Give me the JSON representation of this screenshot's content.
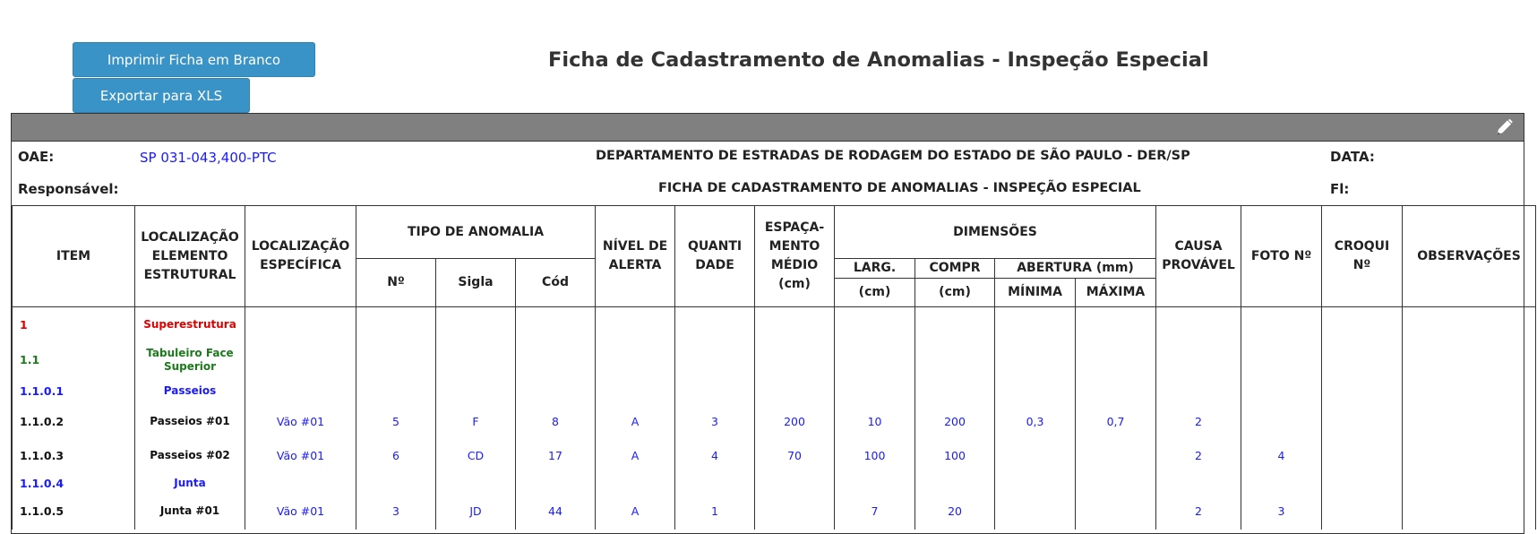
{
  "buttons": {
    "print": "Imprimir Ficha em Branco",
    "export": "Exportar para XLS"
  },
  "page_title": "Ficha de Cadastramento de Anomalias - Inspeção Especial",
  "header": {
    "oae_label": "OAE:",
    "oae_value": "SP 031-043,400-PTC",
    "dept": "DEPARTAMENTO DE ESTRADAS DE RODAGEM DO ESTADO DE SÃO PAULO - DER/SP",
    "data_label": "DATA:",
    "responsavel_label": "Responsável:",
    "ficha": "FICHA DE CADASTRAMENTO DE ANOMALIAS - INSPEÇÃO ESPECIAL",
    "fl_label": "Fl:"
  },
  "columns": {
    "item": "ITEM",
    "loc_elemento": "LOCALIZAÇÃO ELEMENTO ESTRUTURAL",
    "loc_especifica": "LOCALIZAÇÃO ESPECÍFICA",
    "tipo_anomalia": "TIPO DE ANOMALIA",
    "num": "Nº",
    "sigla": "Sigla",
    "cod": "Cód",
    "nivel_alerta": "NÍVEL DE ALERTA",
    "quantidade": "QUANTI DADE",
    "espacamento": "ESPAÇA- MENTO MÉDIO",
    "espacamento_unit": "(cm)",
    "dimensoes": "DIMENSÕES",
    "larg": "LARG.",
    "larg_unit": "(cm)",
    "compr": "COMPR",
    "compr_unit": "(cm)",
    "abertura": "ABERTURA (mm)",
    "minima": "MÍNIMA",
    "maxima": "MÁXIMA",
    "causa": "CAUSA PROVÁVEL",
    "foto": "FOTO Nº",
    "croqui": "CROQUI Nº",
    "observacoes": "OBSERVAÇÕES"
  },
  "rows": [
    {
      "item": "1",
      "loc": "Superestrutura",
      "espec": "",
      "num": "",
      "sigla": "",
      "cod": "",
      "nivel": "",
      "qtd": "",
      "esp": "",
      "larg": "",
      "compr": "",
      "min": "",
      "max": "",
      "causa": "",
      "foto": "",
      "croqui": "",
      "obs": ""
    },
    {
      "item": "1.1",
      "loc": "Tabuleiro Face Superior",
      "espec": "",
      "num": "",
      "sigla": "",
      "cod": "",
      "nivel": "",
      "qtd": "",
      "esp": "",
      "larg": "",
      "compr": "",
      "min": "",
      "max": "",
      "causa": "",
      "foto": "",
      "croqui": "",
      "obs": ""
    },
    {
      "item": "1.1.0.1",
      "loc": "Passeios",
      "espec": "",
      "num": "",
      "sigla": "",
      "cod": "",
      "nivel": "",
      "qtd": "",
      "esp": "",
      "larg": "",
      "compr": "",
      "min": "",
      "max": "",
      "causa": "",
      "foto": "",
      "croqui": "",
      "obs": ""
    },
    {
      "item": "1.1.0.2",
      "loc": "Passeios #01",
      "espec": "Vão #01",
      "num": "5",
      "sigla": "F",
      "cod": "8",
      "nivel": "A",
      "qtd": "3",
      "esp": "200",
      "larg": "10",
      "compr": "200",
      "min": "0,3",
      "max": "0,7",
      "causa": "2",
      "foto": "",
      "croqui": "",
      "obs": ""
    },
    {
      "item": "1.1.0.3",
      "loc": "Passeios #02",
      "espec": "Vão #01",
      "num": "6",
      "sigla": "CD",
      "cod": "17",
      "nivel": "A",
      "qtd": "4",
      "esp": "70",
      "larg": "100",
      "compr": "100",
      "min": "",
      "max": "",
      "causa": "2",
      "foto": "4",
      "croqui": "",
      "obs": ""
    },
    {
      "item": "1.1.0.4",
      "loc": "Junta",
      "espec": "",
      "num": "",
      "sigla": "",
      "cod": "",
      "nivel": "",
      "qtd": "",
      "esp": "",
      "larg": "",
      "compr": "",
      "min": "",
      "max": "",
      "causa": "",
      "foto": "",
      "croqui": "",
      "obs": ""
    },
    {
      "item": "1.1.0.5",
      "loc": "Junta #01",
      "espec": "Vão #01",
      "num": "3",
      "sigla": "JD",
      "cod": "44",
      "nivel": "A",
      "qtd": "1",
      "esp": "",
      "larg": "7",
      "compr": "20",
      "min": "",
      "max": "",
      "causa": "2",
      "foto": "3",
      "croqui": "",
      "obs": ""
    }
  ],
  "row_colors": [
    "#e00000",
    "#1c7a1c",
    "#1a1aff",
    "#111111",
    "#111111",
    "#1a1aff",
    "#111111"
  ],
  "icons": {
    "toolbar_edit": "pencil-icon"
  }
}
